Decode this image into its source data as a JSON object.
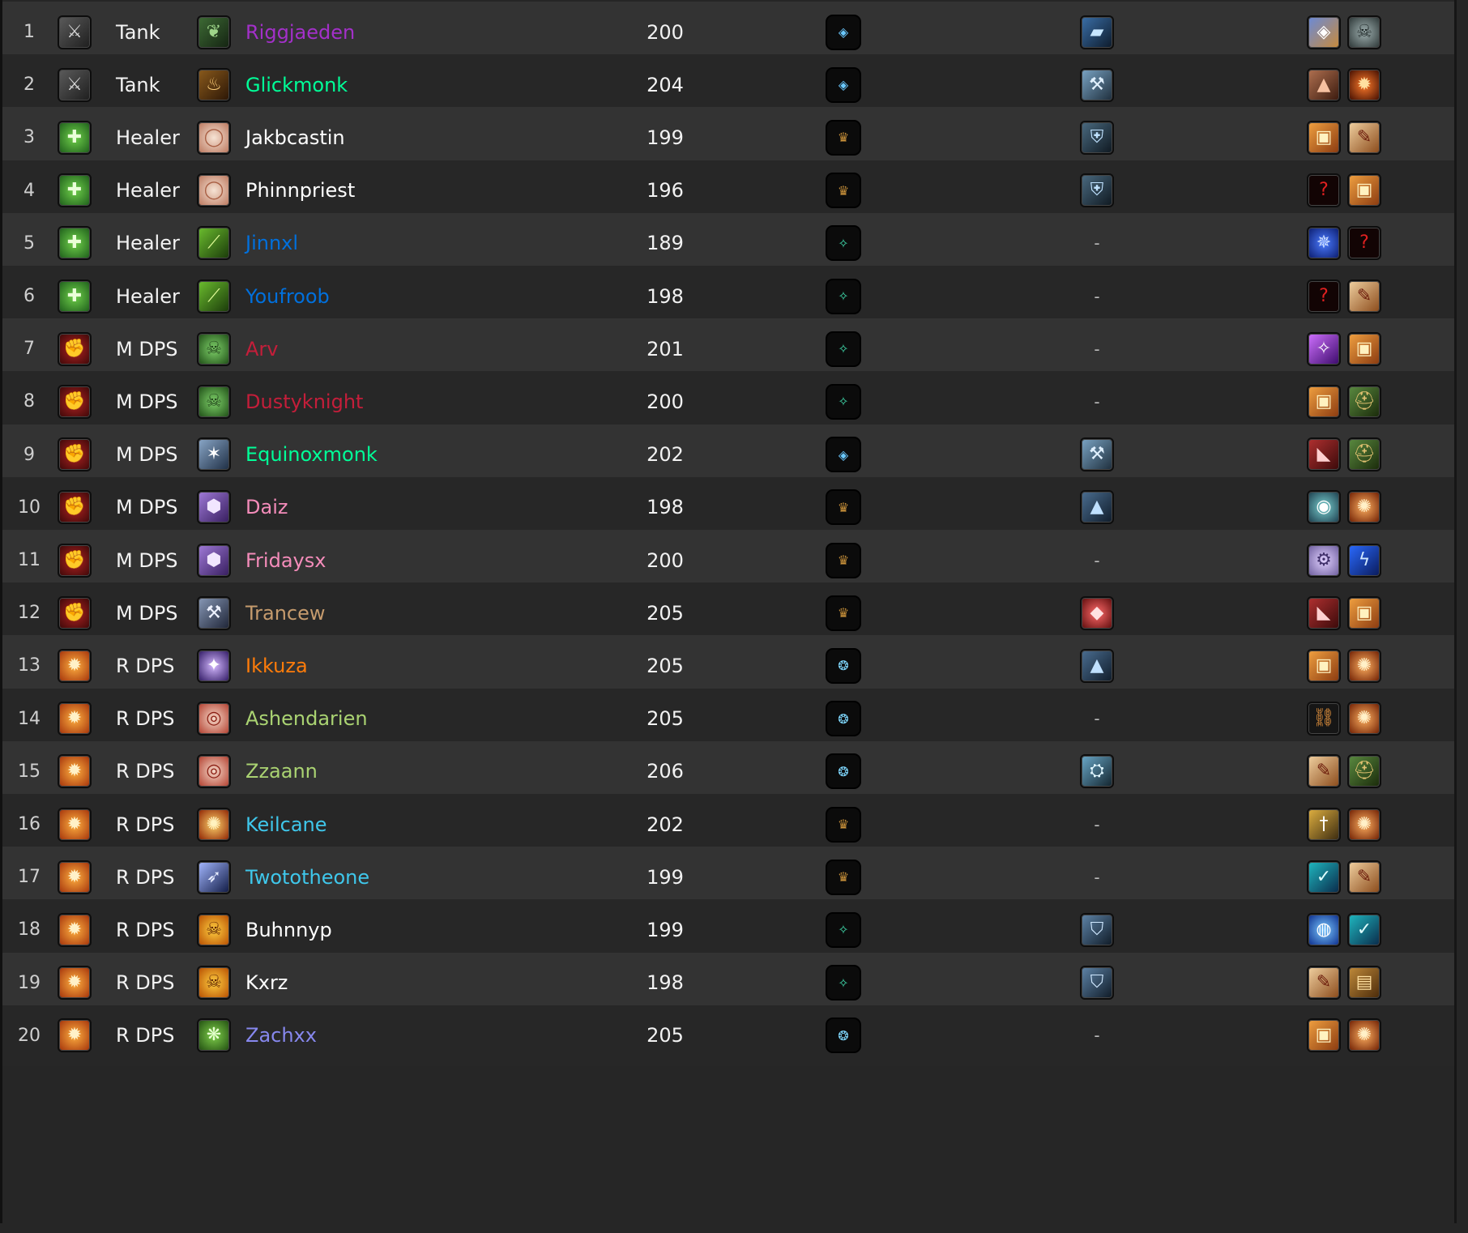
{
  "colors": {
    "row_odd": "#333333",
    "row_even": "#272727",
    "class": {
      "druid": "#ff7c0a",
      "monk": "#00ff98",
      "priest": "#ffffff",
      "shaman": "#0070dd",
      "deathknight": "#c41e3a",
      "demonhunter": "#a330c9",
      "paladin": "#f48cba",
      "warrior": "#c69b6d",
      "mage": "#3fc7eb",
      "hunter": "#aad372",
      "warlock": "#8788ee",
      "rogue": "#fff468"
    }
  },
  "roster": [
    {
      "num": "1",
      "role": "Tank",
      "role_icon": "tank-icon",
      "class_icon": "druid-guardian-icon",
      "name": "Riggjaeden",
      "name_color": "#a330c9",
      "ilvl": "200",
      "covenant": "kyrian-icon",
      "tier": "tier-bracers-icon",
      "trinkets": [
        "trinket-rune-icon",
        "trinket-skull-icon"
      ]
    },
    {
      "num": "2",
      "role": "Tank",
      "role_icon": "tank-icon",
      "class_icon": "monk-brewmaster-icon",
      "name": "Glickmonk",
      "name_color": "#00ff98",
      "ilvl": "204",
      "covenant": "kyrian-icon",
      "tier": "tier-axe-icon",
      "trinkets": [
        "trinket-ore-icon",
        "trinket-fire-icon"
      ]
    },
    {
      "num": "3",
      "role": "Healer",
      "role_icon": "healer-icon",
      "class_icon": "priest-discipline-icon",
      "name": "Jakbcastin",
      "name_color": "#ffffff",
      "ilvl": "199",
      "covenant": "venthyr-icon",
      "tier": "tier-chest-icon",
      "trinkets": [
        "trinket-chest-icon",
        "trinket-scroll-icon"
      ]
    },
    {
      "num": "4",
      "role": "Healer",
      "role_icon": "healer-icon",
      "class_icon": "priest-discipline-icon",
      "name": "Phinnpriest",
      "name_color": "#ffffff",
      "ilvl": "196",
      "covenant": "venthyr-icon",
      "tier": "tier-chest-icon",
      "trinkets": [
        "trinket-unknown-icon",
        "trinket-chest-icon"
      ]
    },
    {
      "num": "5",
      "role": "Healer",
      "role_icon": "healer-icon",
      "class_icon": "shaman-restoration-icon",
      "name": "Jinnxl",
      "name_color": "#0070dd",
      "ilvl": "189",
      "covenant": "necrolord-icon",
      "tier": "-",
      "trinkets": [
        "trinket-rune-blue-icon",
        "trinket-unknown-icon"
      ]
    },
    {
      "num": "6",
      "role": "Healer",
      "role_icon": "healer-icon",
      "class_icon": "shaman-restoration-icon",
      "name": "Youfroob",
      "name_color": "#0070dd",
      "ilvl": "198",
      "covenant": "necrolord-icon",
      "tier": "-",
      "trinkets": [
        "trinket-unknown-icon",
        "trinket-scroll-icon"
      ]
    },
    {
      "num": "7",
      "role": "M DPS",
      "role_icon": "melee-dps-icon",
      "class_icon": "deathknight-unholy-icon",
      "name": "Arv",
      "name_color": "#c41e3a",
      "ilvl": "201",
      "covenant": "necrolord-icon",
      "tier": "-",
      "trinkets": [
        "trinket-crystal-icon",
        "trinket-chest-icon"
      ]
    },
    {
      "num": "8",
      "role": "M DPS",
      "role_icon": "melee-dps-icon",
      "class_icon": "deathknight-unholy-icon",
      "name": "Dustyknight",
      "name_color": "#c41e3a",
      "ilvl": "200",
      "covenant": "necrolord-icon",
      "tier": "-",
      "trinkets": [
        "trinket-chest-icon",
        "trinket-helm-icon"
      ]
    },
    {
      "num": "9",
      "role": "M DPS",
      "role_icon": "melee-dps-icon",
      "class_icon": "monk-windwalker-icon",
      "name": "Equinoxmonk",
      "name_color": "#00ff98",
      "ilvl": "202",
      "covenant": "kyrian-icon",
      "tier": "tier-axe-icon",
      "trinkets": [
        "trinket-book-red-icon",
        "trinket-helm-icon"
      ]
    },
    {
      "num": "10",
      "role": "M DPS",
      "role_icon": "melee-dps-icon",
      "class_icon": "paladin-retribution-icon",
      "name": "Daiz",
      "name_color": "#f48cba",
      "ilvl": "198",
      "covenant": "venthyr-icon",
      "tier": "tier-cloak-icon",
      "trinkets": [
        "trinket-eye-icon",
        "trinket-orb-icon"
      ]
    },
    {
      "num": "11",
      "role": "M DPS",
      "role_icon": "melee-dps-icon",
      "class_icon": "paladin-retribution-icon",
      "name": "Fridaysx",
      "name_color": "#f48cba",
      "ilvl": "200",
      "covenant": "venthyr-icon",
      "tier": "-",
      "trinkets": [
        "trinket-gear-icon",
        "trinket-lightning-icon"
      ]
    },
    {
      "num": "12",
      "role": "M DPS",
      "role_icon": "melee-dps-icon",
      "class_icon": "warrior-arms-icon",
      "name": "Trancew",
      "name_color": "#c69b6d",
      "ilvl": "205",
      "covenant": "venthyr-icon",
      "tier": "tier-gem-icon",
      "trinkets": [
        "trinket-book-red-icon",
        "trinket-chest-icon"
      ]
    },
    {
      "num": "13",
      "role": "R DPS",
      "role_icon": "ranged-dps-icon",
      "class_icon": "druid-balance-icon",
      "name": "Ikkuza",
      "name_color": "#ff7c0a",
      "ilvl": "205",
      "covenant": "nightfae-icon",
      "tier": "tier-cloak-icon",
      "trinkets": [
        "trinket-chest-icon",
        "trinket-orb-icon"
      ]
    },
    {
      "num": "14",
      "role": "R DPS",
      "role_icon": "ranged-dps-icon",
      "class_icon": "hunter-marksman-icon",
      "name": "Ashendarien",
      "name_color": "#aad372",
      "ilvl": "205",
      "covenant": "nightfae-icon",
      "tier": "-",
      "trinkets": [
        "trinket-chain-icon",
        "trinket-orb-icon"
      ]
    },
    {
      "num": "15",
      "role": "R DPS",
      "role_icon": "ranged-dps-icon",
      "class_icon": "hunter-marksman-icon",
      "name": "Zzaann",
      "name_color": "#aad372",
      "ilvl": "206",
      "covenant": "nightfae-icon",
      "tier": "tier-shoulder-icon",
      "trinkets": [
        "trinket-scroll-icon",
        "trinket-helm-icon"
      ]
    },
    {
      "num": "16",
      "role": "R DPS",
      "role_icon": "ranged-dps-icon",
      "class_icon": "mage-fire-icon",
      "name": "Keilcane",
      "name_color": "#3fc7eb",
      "ilvl": "202",
      "covenant": "venthyr-icon",
      "tier": "-",
      "trinkets": [
        "trinket-dagger-icon",
        "trinket-orb-icon"
      ]
    },
    {
      "num": "17",
      "role": "R DPS",
      "role_icon": "ranged-dps-icon",
      "class_icon": "mage-frost-icon",
      "name": "Twototheone",
      "name_color": "#3fc7eb",
      "ilvl": "199",
      "covenant": "venthyr-icon",
      "tier": "-",
      "trinkets": [
        "trinket-rune-teal-icon",
        "trinket-scroll-icon"
      ]
    },
    {
      "num": "18",
      "role": "R DPS",
      "role_icon": "ranged-dps-icon",
      "class_icon": "priest-shadow-skull-icon",
      "name": "Buhnnyp",
      "name_color": "#ffffff",
      "ilvl": "199",
      "covenant": "necrolord-icon",
      "tier": "tier-shield-icon",
      "trinkets": [
        "trinket-frost-orb-icon",
        "trinket-rune-teal-icon"
      ]
    },
    {
      "num": "19",
      "role": "R DPS",
      "role_icon": "ranged-dps-icon",
      "class_icon": "priest-shadow-skull-icon",
      "name": "Kxrz",
      "name_color": "#ffffff",
      "ilvl": "198",
      "covenant": "necrolord-icon",
      "tier": "tier-shield-icon",
      "trinkets": [
        "trinket-scroll-icon",
        "trinket-book-icon"
      ]
    },
    {
      "num": "20",
      "role": "R DPS",
      "role_icon": "ranged-dps-icon",
      "class_icon": "warlock-affliction-icon",
      "name": "Zachxx",
      "name_color": "#8788ee",
      "ilvl": "205",
      "covenant": "nightfae-icon",
      "tier": "-",
      "trinkets": [
        "trinket-chest-icon",
        "trinket-orb-icon"
      ]
    }
  ]
}
